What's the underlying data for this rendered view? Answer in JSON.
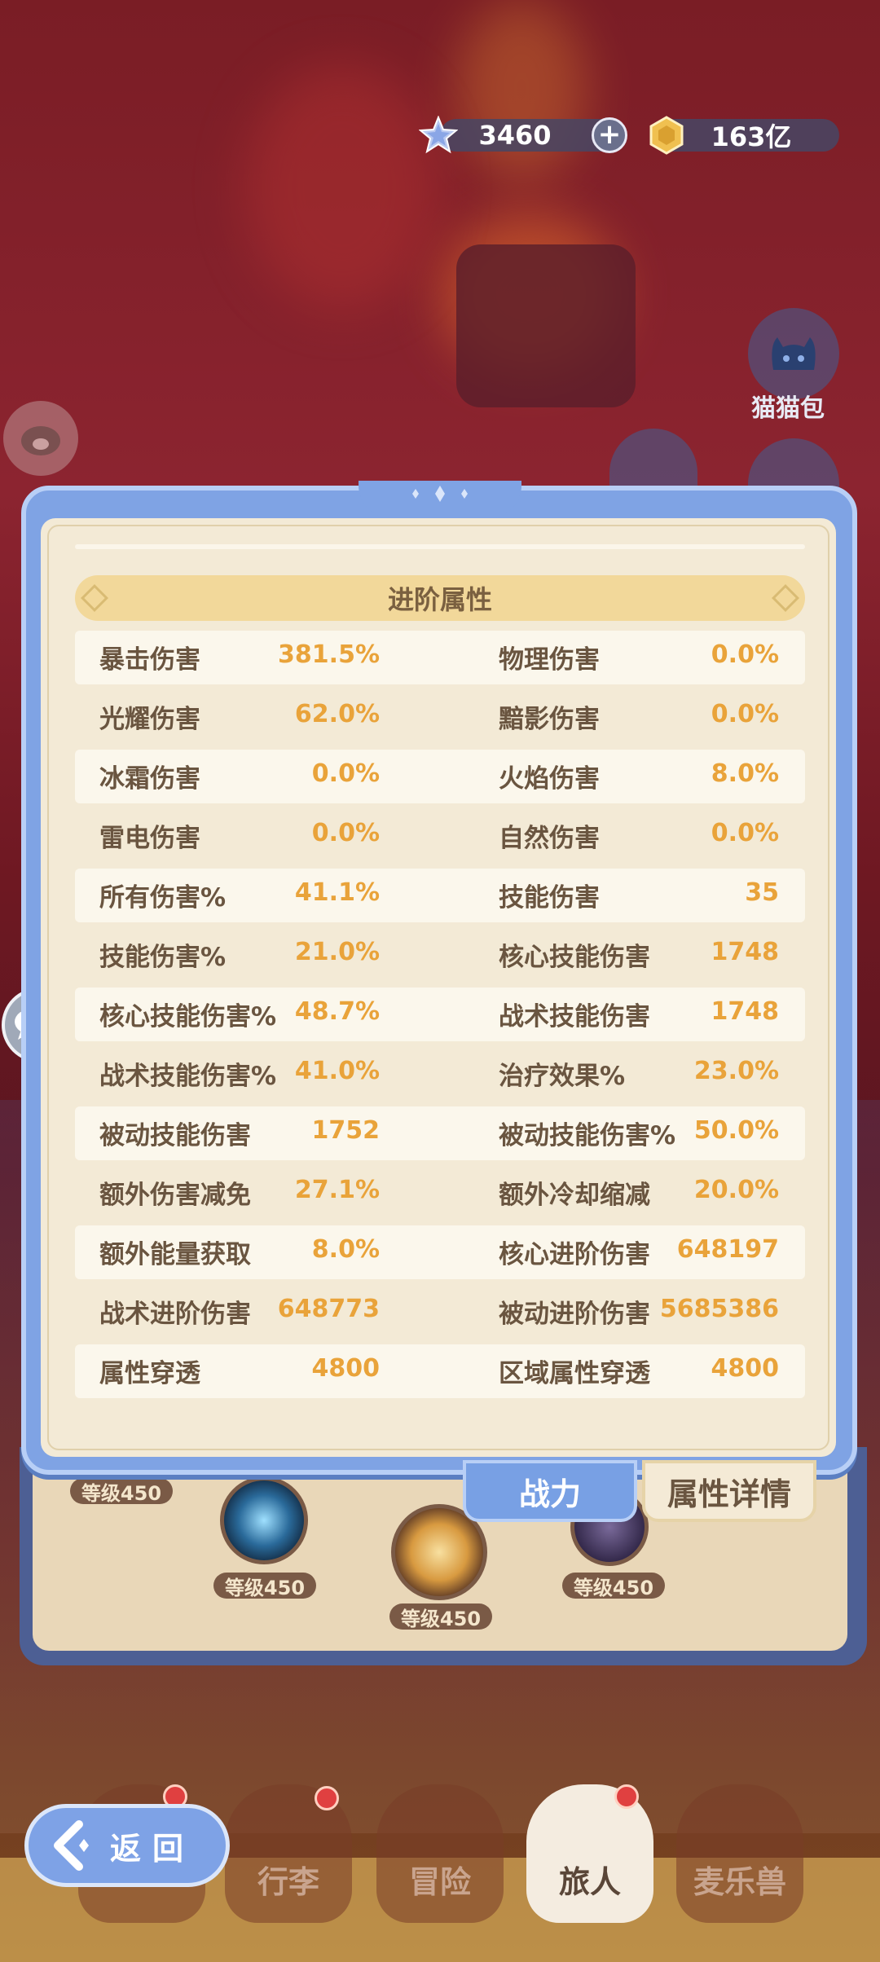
{
  "currency": {
    "gems": "3460",
    "gold": "163亿",
    "gem_icon": "star-gem-icon",
    "gold_icon": "gold-coin-icon",
    "plus_label": "+"
  },
  "side": {
    "cat_bag_label": "猫猫包"
  },
  "panel": {
    "section_title": "进阶属性",
    "rows": [
      {
        "l1": "暴击伤害",
        "v1": "381.5%",
        "l2": "物理伤害",
        "v2": "0.0%"
      },
      {
        "l1": "光耀伤害",
        "v1": "62.0%",
        "l2": "黯影伤害",
        "v2": "0.0%"
      },
      {
        "l1": "冰霜伤害",
        "v1": "0.0%",
        "l2": "火焰伤害",
        "v2": "8.0%"
      },
      {
        "l1": "雷电伤害",
        "v1": "0.0%",
        "l2": "自然伤害",
        "v2": "0.0%"
      },
      {
        "l1": "所有伤害%",
        "v1": "41.1%",
        "l2": "技能伤害",
        "v2": "35"
      },
      {
        "l1": "技能伤害%",
        "v1": "21.0%",
        "l2": "核心技能伤害",
        "v2": "1748"
      },
      {
        "l1": "核心技能伤害%",
        "v1": "48.7%",
        "l2": "战术技能伤害",
        "v2": "1748"
      },
      {
        "l1": "战术技能伤害%",
        "v1": "41.0%",
        "l2": "治疗效果%",
        "v2": "23.0%"
      },
      {
        "l1": "被动技能伤害",
        "v1": "1752",
        "l2": "被动技能伤害%",
        "v2": "50.0%"
      },
      {
        "l1": "额外伤害减免",
        "v1": "27.1%",
        "l2": "额外冷却缩减",
        "v2": "20.0%"
      },
      {
        "l1": "额外能量获取",
        "v1": "8.0%",
        "l2": "核心进阶伤害",
        "v2": "648197"
      },
      {
        "l1": "战术进阶伤害",
        "v1": "648773",
        "l2": "被动进阶伤害",
        "v2": "5685386"
      },
      {
        "l1": "属性穿透",
        "v1": "4800",
        "l2": "区域属性穿透",
        "v2": "4800"
      }
    ]
  },
  "tabs": {
    "power": "战力",
    "details": "属性详情"
  },
  "skills": {
    "badge1": "等级450",
    "badge2": "等级450",
    "badge3": "等级450",
    "badge4": "等级450"
  },
  "nav": {
    "back": "返回",
    "inventory": "行李",
    "adventure": "冒险",
    "traveler": "旅人",
    "pet": "麦乐兽"
  },
  "colors": {
    "panel_blue": "#7fa3e4",
    "panel_cream": "#f3ead6",
    "value_orange": "#e9a33a",
    "label_brown": "#6a5540"
  }
}
